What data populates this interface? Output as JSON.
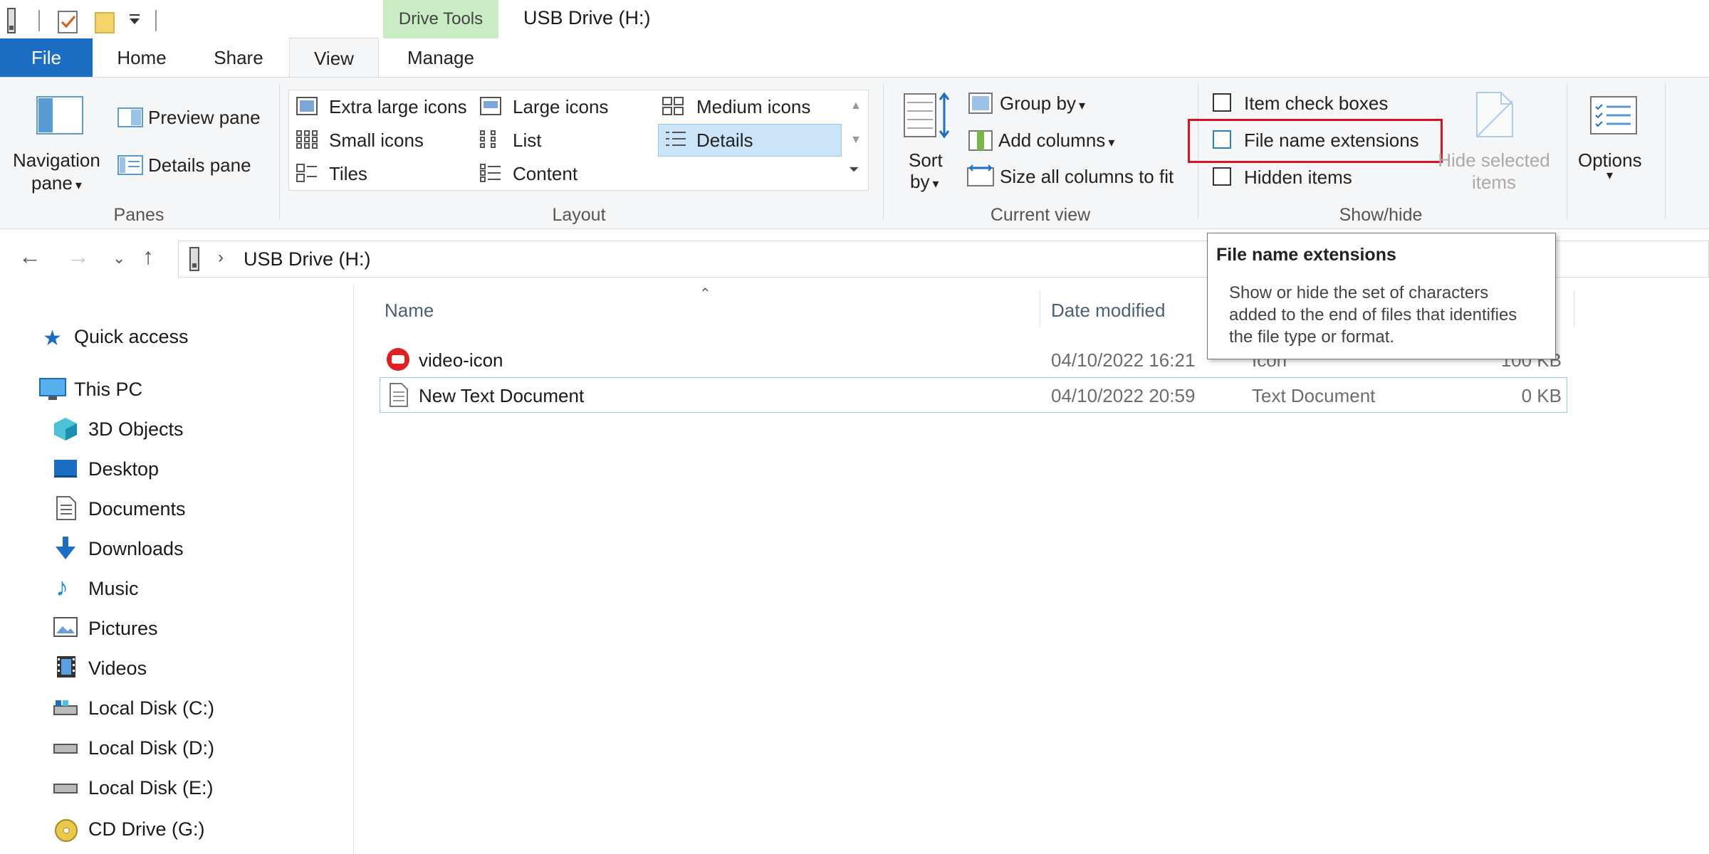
{
  "title_bar": {
    "contextual_tab": "Drive Tools",
    "window_title": "USB Drive (H:)"
  },
  "tabs": [
    {
      "label": "File"
    },
    {
      "label": "Home"
    },
    {
      "label": "Share"
    },
    {
      "label": "View"
    },
    {
      "label": "Manage"
    }
  ],
  "ribbon": {
    "panes": {
      "navigation_pane_line1": "Navigation",
      "navigation_pane_line2": "pane",
      "preview_pane": "Preview pane",
      "details_pane": "Details pane",
      "group_label": "Panes"
    },
    "layout": {
      "extra_large_icons": "Extra large icons",
      "large_icons": "Large icons",
      "medium_icons": "Medium icons",
      "small_icons": "Small icons",
      "list": "List",
      "details": "Details",
      "tiles": "Tiles",
      "content": "Content",
      "group_label": "Layout",
      "selected": "Details"
    },
    "current_view": {
      "sort_by_line1": "Sort",
      "sort_by_line2": "by",
      "group_by": "Group by",
      "add_columns": "Add columns",
      "size_all_columns": "Size all columns to fit",
      "group_label": "Current view"
    },
    "show_hide": {
      "item_check_boxes": "Item check boxes",
      "file_name_extensions": "File name extensions",
      "hidden_items": "Hidden items",
      "hide_selected_line1": "Hide selected",
      "hide_selected_line2": "items",
      "group_label": "Show/hide",
      "item_check_boxes_checked": false,
      "file_name_extensions_checked": false,
      "hidden_items_checked": false
    },
    "options": {
      "label": "Options"
    }
  },
  "address": {
    "path": "USB Drive (H:)"
  },
  "nav_pane": {
    "quick_access": "Quick access",
    "this_pc": "This PC",
    "items": [
      {
        "label": "3D Objects",
        "icon": "cube-icon"
      },
      {
        "label": "Desktop",
        "icon": "desktop-icon"
      },
      {
        "label": "Documents",
        "icon": "documents-icon"
      },
      {
        "label": "Downloads",
        "icon": "downloads-icon"
      },
      {
        "label": "Music",
        "icon": "music-icon"
      },
      {
        "label": "Pictures",
        "icon": "pictures-icon"
      },
      {
        "label": "Videos",
        "icon": "videos-icon"
      },
      {
        "label": "Local Disk (C:)",
        "icon": "drive-icon"
      },
      {
        "label": "Local Disk (D:)",
        "icon": "drive-icon"
      },
      {
        "label": "Local Disk (E:)",
        "icon": "drive-icon"
      },
      {
        "label": "CD Drive (G:)",
        "icon": "cd-icon"
      }
    ]
  },
  "file_list": {
    "columns": {
      "name": "Name",
      "date_modified": "Date modified"
    },
    "rows": [
      {
        "name": "video-icon",
        "date": "04/10/2022 16:21",
        "type": "Icon",
        "size": "100 KB",
        "icon": "video-file-icon"
      },
      {
        "name": "New Text Document",
        "date": "04/10/2022 20:59",
        "type": "Text Document",
        "size": "0 KB",
        "icon": "text-file-icon"
      }
    ]
  },
  "tooltip": {
    "title": "File name extensions",
    "body": "Show or hide the set of characters added to the end of files that identifies the file type or format."
  },
  "colors": {
    "file_tab": "#1b6ec2",
    "contextual_tab": "#c9ecc4",
    "selection": "#cce4f7",
    "highlight_box": "#d9141e"
  }
}
